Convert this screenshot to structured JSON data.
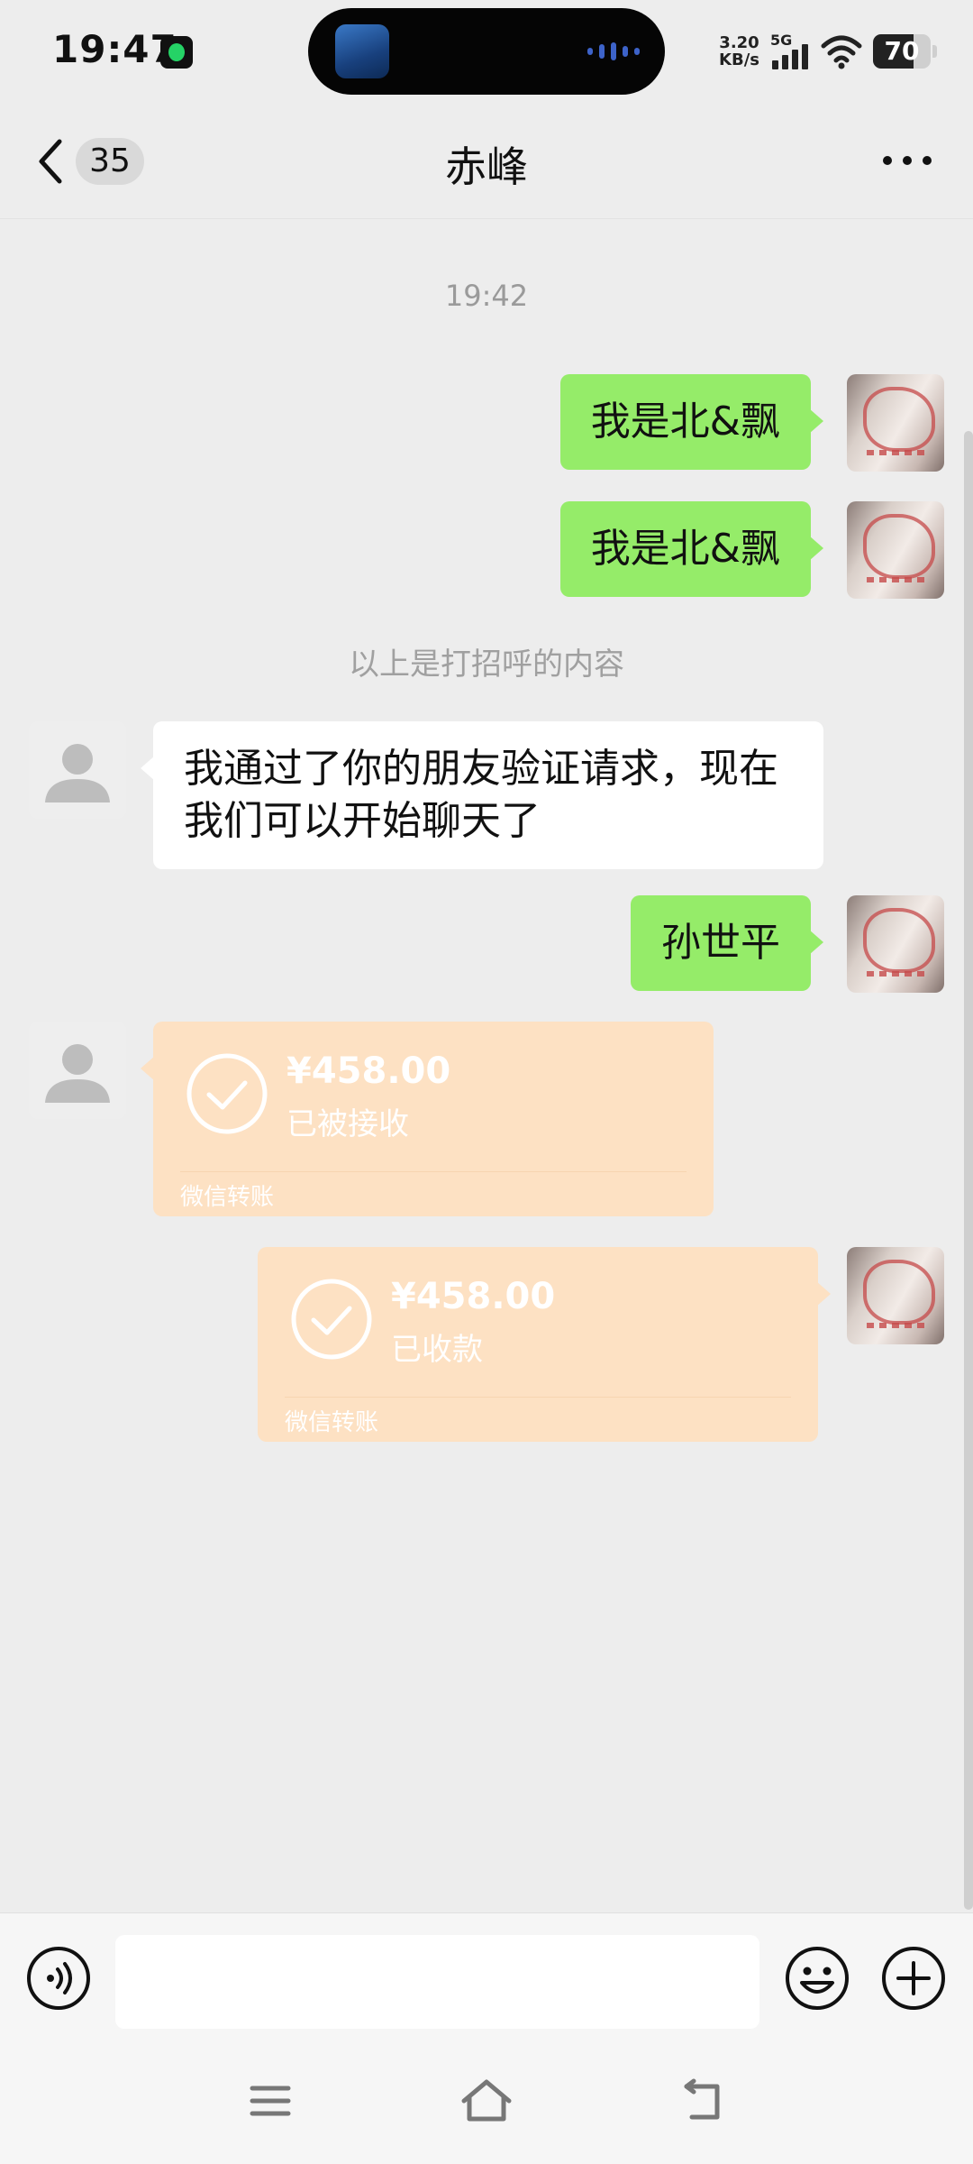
{
  "status_bar": {
    "time": "19:47",
    "app_icon": "music-app-icon",
    "speed_value": "3.20",
    "speed_unit": "KB/s",
    "network_label": "5G",
    "battery_percent": "70",
    "battery_level": 0.7,
    "icons": [
      "signal-icon",
      "wifi-icon",
      "battery-icon"
    ]
  },
  "header": {
    "back_icon": "chevron-left-icon",
    "unread_count": "35",
    "title": "赤峰",
    "more_icon": "more-dots-icon"
  },
  "chat": {
    "timestamp": "19:42",
    "system_notice": "以上是打招呼的内容",
    "messages": [
      {
        "sender": "self",
        "type": "text",
        "text": "我是北&飘"
      },
      {
        "sender": "self",
        "type": "text",
        "text": "我是北&飘"
      },
      {
        "sender": "peer",
        "type": "text",
        "text": "我通过了你的朋友验证请求，现在我们可以开始聊天了"
      },
      {
        "sender": "self",
        "type": "text",
        "text": "孙世平"
      },
      {
        "sender": "peer",
        "type": "transfer",
        "amount": "¥458.00",
        "status": "已被接收",
        "source": "微信转账"
      },
      {
        "sender": "self",
        "type": "transfer",
        "amount": "¥458.00",
        "status": "已收款",
        "source": "微信转账"
      }
    ]
  },
  "input_bar": {
    "voice_icon": "voice-icon",
    "text_value": "",
    "emoji_icon": "emoji-icon",
    "plus_icon": "plus-icon"
  },
  "system_nav": {
    "icons": [
      "menu-icon",
      "home-icon",
      "back-icon"
    ]
  },
  "colors": {
    "background": "#ededed",
    "self_bubble": "#95ec69",
    "peer_bubble": "#ffffff",
    "transfer_bubble": "#fde1c3",
    "accent_text": "#111111"
  }
}
